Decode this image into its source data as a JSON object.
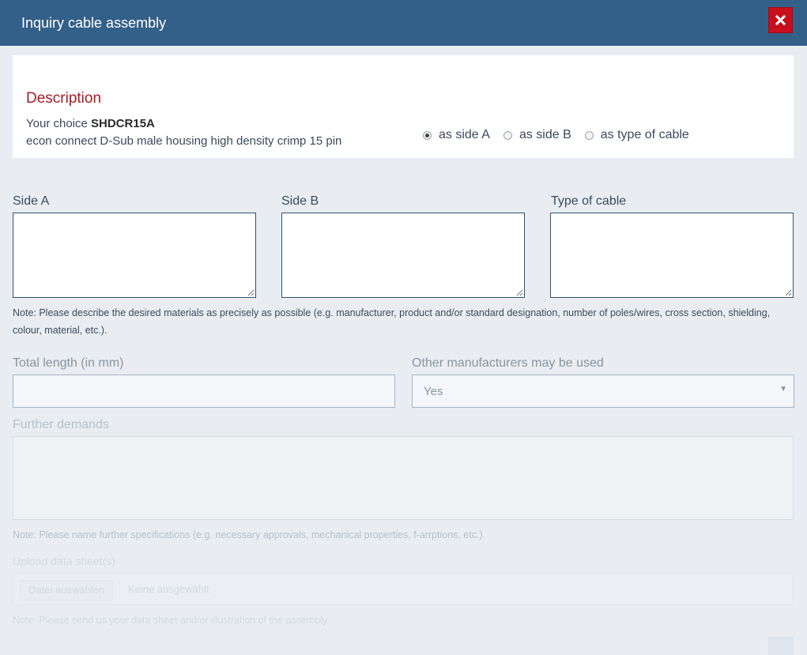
{
  "dialog": {
    "title": "Inquiry cable assembly",
    "close_icon": "close-icon"
  },
  "description": {
    "heading": "Description",
    "your_choice_prefix": "Your choice",
    "product_code": "SHDCR15A",
    "product_description": "econ connect D-Sub male housing high density crimp 15 pin",
    "options": [
      {
        "label": "as side A",
        "checked": true
      },
      {
        "label": "as side B",
        "checked": false
      },
      {
        "label": "as type of cable",
        "checked": false
      }
    ]
  },
  "materials": {
    "side_a_label": "Side A",
    "side_b_label": "Side B",
    "cable_type_label": "Type of cable",
    "note": "Note: Please describe the desired materials as precisely as possible (e.g. manufacturer, product and/or standard designation, number of poles/wires, cross section, shielding, colour, material, etc.)."
  },
  "length": {
    "label": "Total length (in mm)",
    "value": ""
  },
  "manufacturers": {
    "label": "Other manufacturers may be used",
    "selected": "Yes"
  },
  "further": {
    "label": "Further demands",
    "note": "Note: Please name further specifications (e.g. necessary approvals, mechanical properties, f-arrptions, etc.)."
  },
  "upload": {
    "label": "Upload data sheet(s)",
    "button": "Datei auswählen",
    "filename": "Keine ausgewählt",
    "note": "Note: Please send us your data sheet and/or illustration of the assembly"
  },
  "colors": {
    "title_bar": "#336089",
    "close_button": "#c8101c",
    "heading": "#a81a25"
  }
}
